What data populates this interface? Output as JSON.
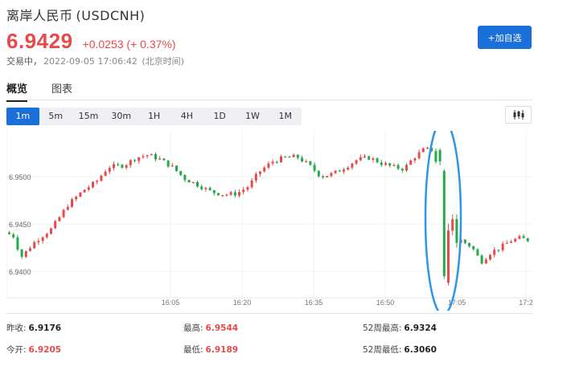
{
  "header": {
    "name": "离岸人民币",
    "symbol": "(USDCNH)",
    "price": "6.9429",
    "change": "+0.0253",
    "change_pct": "(+ 0.37%)",
    "status": "交易中，",
    "timestamp": "2022-09-05 17:06:42",
    "timezone": "(北京时间)",
    "add_button": "+加自选"
  },
  "tabs": [
    {
      "label": "概览",
      "active": true
    },
    {
      "label": "图表",
      "active": false
    }
  ],
  "periods": [
    {
      "label": "1m",
      "active": true
    },
    {
      "label": "5m",
      "active": false
    },
    {
      "label": "15m",
      "active": false
    },
    {
      "label": "30m",
      "active": false
    },
    {
      "label": "1H",
      "active": false
    },
    {
      "label": "4H",
      "active": false
    },
    {
      "label": "1D",
      "active": false
    },
    {
      "label": "1W",
      "active": false
    },
    {
      "label": "1M",
      "active": false
    }
  ],
  "chart_type_icon": "candlestick-icon",
  "colors": {
    "up": "#e84a4a",
    "down": "#27a84a",
    "accent": "#1a6fd8",
    "annotation": "#2f95e6"
  },
  "chart_data": {
    "type": "candlestick",
    "y_ticks": [
      "6.9500",
      "6.9450",
      "6.9400"
    ],
    "x_ticks": [
      "16:05",
      "16:20",
      "16:35",
      "16:50",
      "17:05",
      "17:2"
    ],
    "annotation": "blue-ellipse-highlight"
  },
  "stats": [
    {
      "label": "昨收:",
      "value": "6.9176",
      "color": "black"
    },
    {
      "label": "最高:",
      "value": "6.9544",
      "color": "red"
    },
    {
      "label": "52周最高:",
      "value": "6.9324",
      "color": "black"
    },
    {
      "label": "今开:",
      "value": "6.9205",
      "color": "red"
    },
    {
      "label": "最低:",
      "value": "6.9189",
      "color": "red"
    },
    {
      "label": "52周最低:",
      "value": "6.3060",
      "color": "black"
    }
  ]
}
